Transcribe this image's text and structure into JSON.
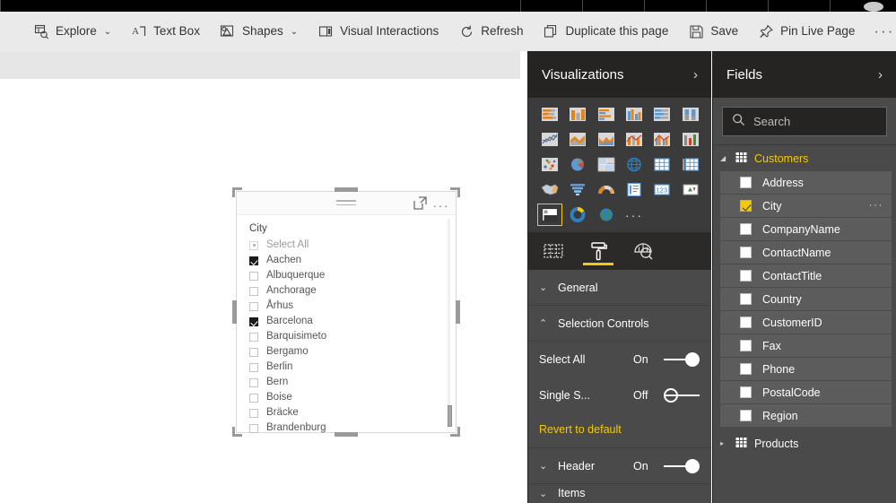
{
  "toolbar": {
    "items": [
      {
        "label": "Explore",
        "icon": "explore-icon",
        "chevron": "⌄"
      },
      {
        "label": "Text Box",
        "icon": "text-box-icon",
        "chevron": ""
      },
      {
        "label": "Shapes",
        "icon": "shapes-icon",
        "chevron": "⌄"
      },
      {
        "label": "Visual Interactions",
        "icon": "visual-interactions-icon",
        "chevron": ""
      },
      {
        "label": "Refresh",
        "icon": "refresh-icon",
        "chevron": ""
      },
      {
        "label": "Duplicate this page",
        "icon": "duplicate-page-icon",
        "chevron": ""
      },
      {
        "label": "Save",
        "icon": "save-icon",
        "chevron": ""
      },
      {
        "label": "Pin Live Page",
        "icon": "pin-icon",
        "chevron": ""
      }
    ],
    "overflow": "···"
  },
  "slicer": {
    "title": "City",
    "header_icons": {
      "filter": "hamburger-icon",
      "focus": "focus-mode-icon",
      "more": "···"
    },
    "items": [
      {
        "label": "Select All",
        "state": "partial"
      },
      {
        "label": "Aachen",
        "state": "checked"
      },
      {
        "label": "Albuquerque",
        "state": "unchecked"
      },
      {
        "label": "Anchorage",
        "state": "unchecked"
      },
      {
        "label": "Århus",
        "state": "unchecked"
      },
      {
        "label": "Barcelona",
        "state": "checked"
      },
      {
        "label": "Barquisimeto",
        "state": "unchecked"
      },
      {
        "label": "Bergamo",
        "state": "unchecked"
      },
      {
        "label": "Berlin",
        "state": "unchecked"
      },
      {
        "label": "Bern",
        "state": "unchecked"
      },
      {
        "label": "Boise",
        "state": "unchecked"
      },
      {
        "label": "Bräcke",
        "state": "unchecked"
      },
      {
        "label": "Brandenburg",
        "state": "unchecked"
      }
    ]
  },
  "visualizations": {
    "title": "Visualizations",
    "chevron": "›",
    "gallery": [
      {
        "name": "stacked-bar-chart-icon",
        "selected": false
      },
      {
        "name": "stacked-column-chart-icon",
        "selected": false
      },
      {
        "name": "clustered-bar-chart-icon",
        "selected": false
      },
      {
        "name": "clustered-column-chart-icon",
        "selected": false
      },
      {
        "name": "100-stacked-bar-chart-icon",
        "selected": false
      },
      {
        "name": "100-stacked-column-chart-icon",
        "selected": false
      },
      {
        "name": "line-chart-icon",
        "selected": false
      },
      {
        "name": "area-chart-icon",
        "selected": false
      },
      {
        "name": "stacked-area-chart-icon",
        "selected": false
      },
      {
        "name": "line-stacked-column-chart-icon",
        "selected": false
      },
      {
        "name": "line-clustered-column-chart-icon",
        "selected": false
      },
      {
        "name": "ribbon-chart-icon",
        "selected": false
      },
      {
        "name": "scatter-chart-icon",
        "selected": false
      },
      {
        "name": "pie-chart-icon",
        "selected": false
      },
      {
        "name": "treemap-icon",
        "selected": false
      },
      {
        "name": "map-icon",
        "selected": false
      },
      {
        "name": "table-icon",
        "selected": false
      },
      {
        "name": "matrix-icon",
        "selected": false
      },
      {
        "name": "filled-map-icon",
        "selected": false
      },
      {
        "name": "funnel-icon",
        "selected": false
      },
      {
        "name": "gauge-icon",
        "selected": false
      },
      {
        "name": "multi-row-card-icon",
        "selected": false
      },
      {
        "name": "card-icon",
        "selected": false
      },
      {
        "name": "kpi-icon",
        "selected": false
      },
      {
        "name": "slicer-icon",
        "selected": true
      },
      {
        "name": "donut-chart-icon",
        "selected": false
      },
      {
        "name": "arcgis-map-icon",
        "selected": false
      }
    ],
    "gallery_more": "···",
    "tabs": [
      {
        "name": "fields-tab",
        "icon": "fields-grid-icon",
        "active": false
      },
      {
        "name": "format-tab",
        "icon": "paint-roller-icon",
        "active": true
      },
      {
        "name": "analytics-tab",
        "icon": "analytics-icon",
        "active": false
      }
    ],
    "format": {
      "sections": [
        {
          "label": "General",
          "expanded": false,
          "arrow": "⌄"
        },
        {
          "label": "Selection Controls",
          "expanded": true,
          "arrow": "⌃"
        }
      ],
      "selection_controls": {
        "rows": [
          {
            "label": "Select All",
            "state": "On",
            "on": true
          },
          {
            "label": "Single S...",
            "state": "Off",
            "on": false
          }
        ],
        "revert": "Revert to default"
      },
      "header": {
        "label": "Header",
        "state": "On",
        "on": true,
        "arrow": "⌄"
      },
      "items_partial": {
        "label": "Items",
        "arrow": "⌄"
      }
    }
  },
  "fields": {
    "title": "Fields",
    "chevron": "›",
    "search": {
      "placeholder": "Search",
      "icon": "search-icon",
      "value": ""
    },
    "tables": [
      {
        "name": "Customers",
        "expanded": true,
        "triangle": "◢",
        "fields": [
          {
            "label": "Address",
            "checked": false,
            "menu": ""
          },
          {
            "label": "City",
            "checked": true,
            "menu": "···"
          },
          {
            "label": "CompanyName",
            "checked": false,
            "menu": ""
          },
          {
            "label": "ContactName",
            "checked": false,
            "menu": ""
          },
          {
            "label": "ContactTitle",
            "checked": false,
            "menu": ""
          },
          {
            "label": "Country",
            "checked": false,
            "menu": ""
          },
          {
            "label": "CustomerID",
            "checked": false,
            "menu": ""
          },
          {
            "label": "Fax",
            "checked": false,
            "menu": ""
          },
          {
            "label": "Phone",
            "checked": false,
            "menu": ""
          },
          {
            "label": "PostalCode",
            "checked": false,
            "menu": ""
          },
          {
            "label": "Region",
            "checked": false,
            "menu": ""
          }
        ]
      },
      {
        "name": "Products",
        "expanded": false,
        "triangle": "▸",
        "fields": []
      }
    ]
  },
  "colors": {
    "accent_gold": "#f2c811",
    "pane_bg": "#4a4a4a",
    "pane_header_bg": "#252423",
    "toolbar_bg": "#eaeaea",
    "canvas_bg": "#ffffff"
  }
}
